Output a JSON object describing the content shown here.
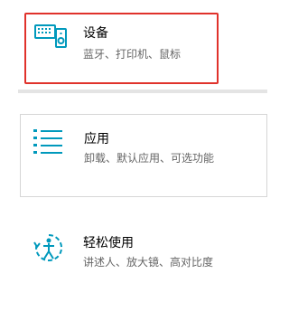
{
  "tiles": {
    "devices": {
      "title": "设备",
      "desc": "蓝牙、打印机、鼠标",
      "icon": "keyboard-speaker-icon"
    },
    "apps": {
      "title": "应用",
      "desc": "卸载、默认应用、可选功能",
      "icon": "app-list-icon"
    },
    "ease": {
      "title": "轻松使用",
      "desc": "讲述人、放大镜、高对比度",
      "icon": "ease-of-access-icon"
    }
  },
  "colors": {
    "accent": "#0099bc",
    "highlight": "#e0322b"
  }
}
